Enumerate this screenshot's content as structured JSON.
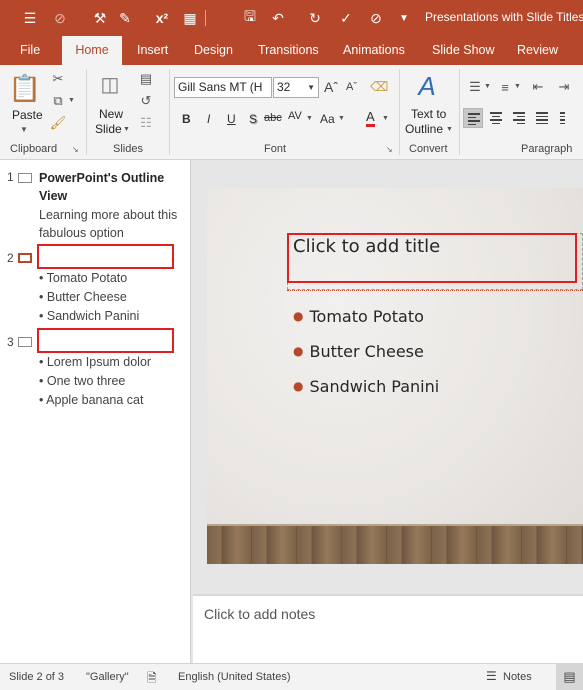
{
  "title_bar": {
    "document_title": "Presentations with Slide Titles.",
    "qat_icons": [
      "touch-mode-icon",
      "disabled-icon",
      "customize-tools-icon",
      "paste-special-icon",
      "superscript-icon",
      "grid-icon",
      "save-icon",
      "undo-icon",
      "redo-icon",
      "spelling-icon",
      "clear-format-icon",
      "dropdown-icon"
    ],
    "superscript_label": "x²"
  },
  "tabs": [
    "File",
    "Home",
    "Insert",
    "Design",
    "Transitions",
    "Animations",
    "Slide Show",
    "Review"
  ],
  "active_tab": "Home",
  "ribbon": {
    "clipboard": {
      "label": "Clipboard",
      "paste": "Paste"
    },
    "slides": {
      "label": "Slides",
      "new_slide_1": "New",
      "new_slide_2": "Slide"
    },
    "font": {
      "label": "Font",
      "font_name": "Gill Sans MT (H",
      "font_size": "32",
      "bold": "B",
      "italic": "I",
      "underline": "U",
      "shadow": "S",
      "strike": "abc",
      "spacing": "AV",
      "case": "Aa",
      "color": "A"
    },
    "convert": {
      "label": "Convert",
      "text_to_1": "Text to",
      "text_to_2": "Outline"
    },
    "paragraph": {
      "label": "Paragraph"
    }
  },
  "outline": {
    "slides": [
      {
        "number": "1",
        "title": "PowerPoint's Outline View",
        "body": "Learning more about this fabulous option"
      },
      {
        "number": "2",
        "title": "",
        "bullets": [
          "Tomato Potato",
          "Butter Cheese",
          "Sandwich Panini"
        ]
      },
      {
        "number": "3",
        "title": "",
        "bullets": [
          "Lorem Ipsum dolor",
          "One two three",
          "Apple banana cat"
        ]
      }
    ]
  },
  "slide": {
    "title_placeholder": "Click to add title",
    "bullets": [
      "Tomato Potato",
      "Butter Cheese",
      "Sandwich Panini"
    ]
  },
  "notes": {
    "placeholder": "Click to add notes"
  },
  "status": {
    "slide_info": "Slide 2 of 3",
    "theme": "\"Gallery\"",
    "language": "English (United States)",
    "notes_button": "Notes"
  },
  "colors": {
    "accent": "#b7472a",
    "highlight_box": "#e02020"
  }
}
